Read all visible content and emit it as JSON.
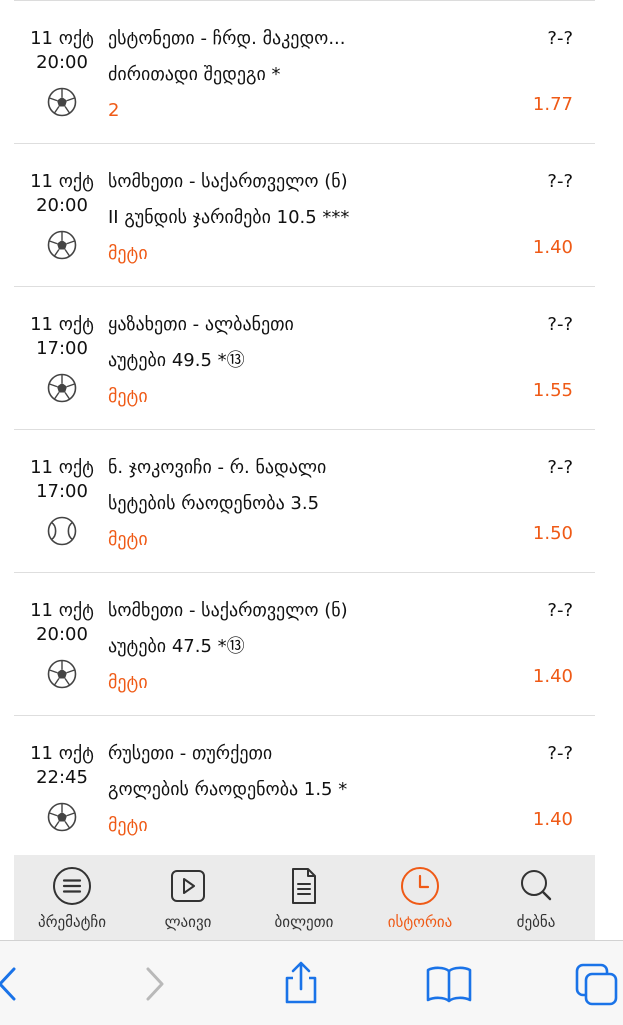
{
  "bets": [
    {
      "date": "11 ოქტ",
      "time": "20:00",
      "sport_icon": "football-icon",
      "match": "ესტონეთი - ჩრდ. მაკედო...",
      "market": "ძირითადი შედეგი *",
      "pick": "2",
      "score": "?-?",
      "odds": "1.77"
    },
    {
      "date": "11 ოქტ",
      "time": "20:00",
      "sport_icon": "football-icon",
      "match": "სომხეთი - საქართველო (ნ)",
      "market": "II გუნდის ჯარიმები 10.5 ***",
      "pick": "მეტი",
      "score": "?-?",
      "odds": "1.40"
    },
    {
      "date": "11 ოქტ",
      "time": "17:00",
      "sport_icon": "football-icon",
      "match": "ყაზახეთი - ალბანეთი",
      "market": "აუტები 49.5 *⑬",
      "pick": "მეტი",
      "score": "?-?",
      "odds": "1.55"
    },
    {
      "date": "11 ოქტ",
      "time": "17:00",
      "sport_icon": "tennis-ball-icon",
      "match": "ნ. ჯოკოვიჩი - რ. ნადალი",
      "market": "სეტების რაოდენობა 3.5",
      "pick": "მეტი",
      "score": "?-?",
      "odds": "1.50"
    },
    {
      "date": "11 ოქტ",
      "time": "20:00",
      "sport_icon": "football-icon",
      "match": "სომხეთი - საქართველო (ნ)",
      "market": "აუტები 47.5 *⑬",
      "pick": "მეტი",
      "score": "?-?",
      "odds": "1.40"
    },
    {
      "date": "11 ოქტ",
      "time": "22:45",
      "sport_icon": "football-icon",
      "match": "რუსეთი - თურქეთი",
      "market": "გოლების რაოდენობა 1.5 *",
      "pick": "მეტი",
      "score": "?-?",
      "odds": "1.40"
    }
  ],
  "tabs": [
    {
      "label": "პრემატჩი",
      "icon": "list-icon",
      "active": false
    },
    {
      "label": "ლაივი",
      "icon": "play-icon",
      "active": false
    },
    {
      "label": "ბილეთი",
      "icon": "document-icon",
      "active": false
    },
    {
      "label": "ისტორია",
      "icon": "clock-icon",
      "active": true
    },
    {
      "label": "ძებნა",
      "icon": "search-icon",
      "active": false
    }
  ],
  "safari_toolbar": {
    "buttons": [
      "back-icon",
      "forward-icon",
      "share-icon",
      "bookmarks-icon",
      "tabs-icon"
    ]
  },
  "colors": {
    "accent": "#ef5a16",
    "ios_blue": "#1a73e8",
    "tabbar_bg": "#ebebeb"
  }
}
